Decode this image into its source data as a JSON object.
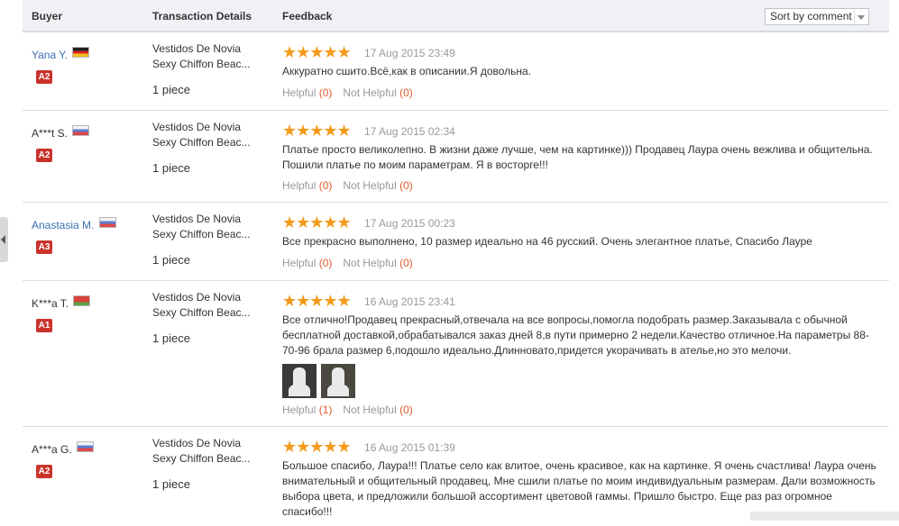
{
  "columns": {
    "buyer": "Buyer",
    "transaction": "Transaction Details",
    "feedback": "Feedback"
  },
  "sort": {
    "label": "Sort by comment"
  },
  "colors": {
    "link": "#3b6fb0",
    "badge": "#c9332b",
    "star": "#f39a1b",
    "count": "#e1592a"
  },
  "reviews": [
    {
      "buyer": "Yana Y.",
      "flag": "de-flag",
      "level": "A2",
      "product_line1": "Vestidos De Novia",
      "product_line2": "Sexy Chiffon Beac...",
      "quantity": "1 piece",
      "stars": "★★★★★",
      "date": "17 Aug 2015 23:49",
      "text": "Аккуратно сшито.Всё,как в описании.Я довольна.",
      "helpful_label": "Helpful",
      "helpful_count": "(0)",
      "not_helpful_label": "Not Helpful",
      "not_helpful_count": "(0)"
    },
    {
      "buyer": "A***t S.",
      "flag": "ru-flag",
      "level": "A2",
      "product_line1": "Vestidos De Novia",
      "product_line2": "Sexy Chiffon Beac...",
      "quantity": "1 piece",
      "stars": "★★★★★",
      "date": "17 Aug 2015 02:34",
      "text": "Платье просто великолепно. В жизни даже лучше, чем на картинке))) Продавец Лаура очень вежлива и общительна. Пошили платье по моим параметрам. Я в восторге!!!",
      "helpful_label": "Helpful",
      "helpful_count": "(0)",
      "not_helpful_label": "Not Helpful",
      "not_helpful_count": "(0)"
    },
    {
      "buyer": "Anastasia M.",
      "flag": "ru-flag",
      "level": "A3",
      "product_line1": "Vestidos De Novia",
      "product_line2": "Sexy Chiffon Beac...",
      "quantity": "1 piece",
      "stars": "★★★★★",
      "date": "17 Aug 2015 00:23",
      "text": "Все прекрасно выполнено, 10 размер идеально на 46 русский. Очень элегантное платье, Спасибо Лауре",
      "helpful_label": "Helpful",
      "helpful_count": "(0)",
      "not_helpful_label": "Not Helpful",
      "not_helpful_count": "(0)"
    },
    {
      "buyer": "K***a T.",
      "flag": "by-flag",
      "level": "A1",
      "product_line1": "Vestidos De Novia",
      "product_line2": "Sexy Chiffon Beac...",
      "quantity": "1 piece",
      "stars": "★★★★★",
      "date": "16 Aug 2015 23:41",
      "text": "Все отлично!Продавец прекрасный,отвечала на все вопросы,помогла подобрать размер.Заказывала с обычной бесплатной доставкой,обрабатывался заказ дней 8,в пути примерно 2 недели.Качество отличное.На параметры 88-70-96 брала размер 6,подошло идеально.Длинновато,придется укорачивать в ателье,но это мелочи.",
      "helpful_label": "Helpful",
      "helpful_count": "(1)",
      "not_helpful_label": "Not Helpful",
      "not_helpful_count": "(0)"
    },
    {
      "buyer": "A***a G.",
      "flag": "ru-flag",
      "level": "A2",
      "product_line1": "Vestidos De Novia",
      "product_line2": "Sexy Chiffon Beac...",
      "quantity": "1 piece",
      "stars": "★★★★★",
      "date": "16 Aug 2015 01:39",
      "text": "Большое спасибо, Лаура!!! Платье село как влитое, очень красивое, как на картинке. Я очень счастлива! Лаура очень внимательный и общительный продавец, Мне сшили платье по моим индивидуальным размерам. Дали возможность выбора цвета, и предложили большой ассортимент цветовой гаммы. Пришло быстро. Еще раз раз огромное спасибо!!!"
    }
  ]
}
